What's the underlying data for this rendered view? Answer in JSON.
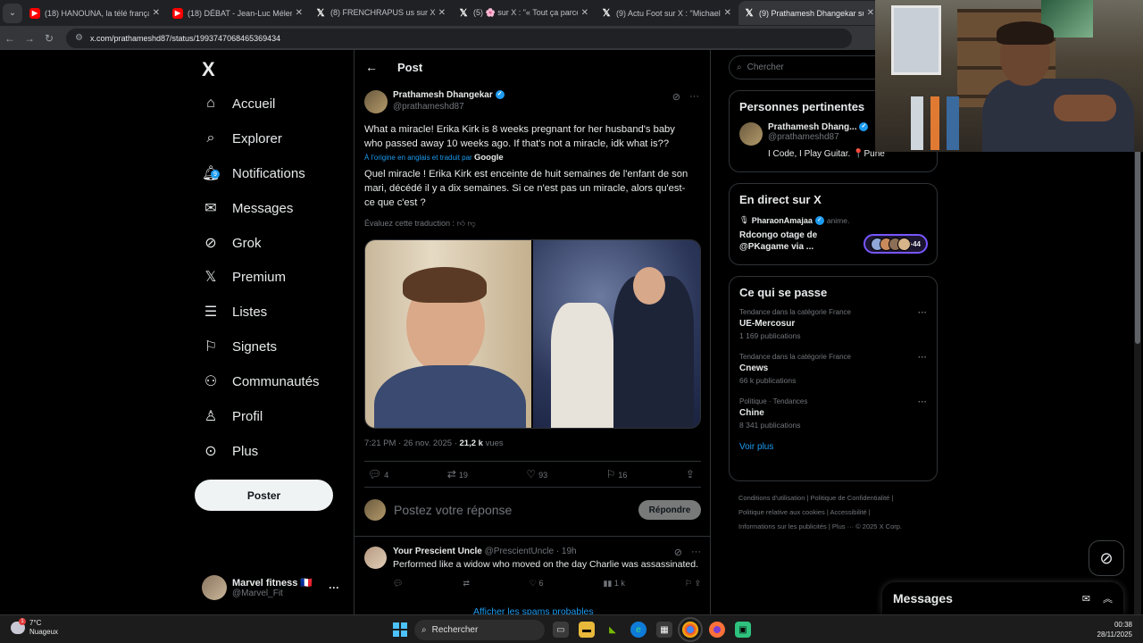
{
  "browser": {
    "tabs": [
      {
        "label": "(18) HANOUNA, la télé français",
        "icon": "youtube-icon",
        "active": false
      },
      {
        "label": "(18) DÉBAT - Jean-Luc Mélench",
        "icon": "youtube-icon",
        "active": false
      },
      {
        "label": "(8) FRENCHRAPUS us sur X : \" 🎩",
        "icon": "x-logo-icon",
        "active": false
      },
      {
        "label": "(5) 🌸 sur X : \"« Tout ça parce q",
        "icon": "x-logo-icon",
        "active": false
      },
      {
        "label": "(9) Actu Foot sur X : \"Michael O",
        "icon": "x-logo-icon",
        "active": false
      },
      {
        "label": "(9) Prathamesh Dhangekar sur",
        "icon": "x-logo-icon",
        "active": true
      }
    ],
    "url": "x.com/prathameshd87/status/1993747068465369434"
  },
  "sidebar": {
    "logo": "X",
    "items": [
      {
        "label": "Accueil",
        "icon": "home-icon"
      },
      {
        "label": "Explorer",
        "icon": "search-icon"
      },
      {
        "label": "Notifications",
        "icon": "bell-icon",
        "badge": "9"
      },
      {
        "label": "Messages",
        "icon": "envelope-icon"
      },
      {
        "label": "Grok",
        "icon": "grok-icon"
      },
      {
        "label": "Premium",
        "icon": "x-logo-icon"
      },
      {
        "label": "Listes",
        "icon": "list-icon"
      },
      {
        "label": "Signets",
        "icon": "bookmark-icon"
      },
      {
        "label": "Communautés",
        "icon": "people-icon"
      },
      {
        "label": "Profil",
        "icon": "person-icon"
      },
      {
        "label": "Plus",
        "icon": "more-circle-icon"
      }
    ],
    "post_button": "Poster",
    "account": {
      "name": "Marvel fitness 🇫🇷",
      "handle": "@Marvel_Fit",
      "more": "···"
    }
  },
  "post": {
    "header": "Post",
    "author_name": "Prathamesh Dhangekar",
    "author_handle": "@prathameshd87",
    "text_original": "What a miracle! Erika Kirk is 8 weeks pregnant for her husband's baby who passed away 10 weeks ago. If that's not a miracle, idk what is??",
    "translation_note": "À l'origine en anglais et traduit par",
    "translation_provider": "Google",
    "text_translated": "Quel miracle ! Erika Kirk est enceinte de huit semaines de l'enfant de son mari, décédé il y a dix semaines. Si ce n'est pas un miracle, alors qu'est-ce que c'est ?",
    "rate_translation": "Évaluez cette traduction :",
    "time": "7:21 PM · 26 nov. 2025 ·",
    "views_count": "21,2 k",
    "views_label": "vues",
    "actions": {
      "replies": "4",
      "reposts": "19",
      "likes": "93",
      "bookmarks": "16"
    },
    "reply_placeholder": "Postez votre réponse",
    "reply_button": "Répondre"
  },
  "reply": {
    "name": "Your Prescient Uncle",
    "handle": "@PrescientUncle",
    "age": "· 19h",
    "text": "Performed like a widow who moved on the day Charlie was assassinated.",
    "likes": "6",
    "views": "1 k"
  },
  "spam_link": "Afficher les spams probables",
  "right": {
    "search_placeholder": "Chercher",
    "relevant": {
      "title": "Personnes pertinentes",
      "name": "Prathamesh Dhang...",
      "handle": "@prathameshd87",
      "bio": "I Code, I Play Guitar. 📍Pune"
    },
    "live": {
      "title": "En direct sur X",
      "user": "PharaonAmajaa",
      "role": "anime.",
      "topic": "Rdcongo otage de @PKagame via ...",
      "count": "+44"
    },
    "trends": {
      "title": "Ce qui se passe",
      "items": [
        {
          "context": "Tendance dans la catégorie France",
          "name": "UE-Mercosur",
          "posts": "1 169 publications"
        },
        {
          "context": "Tendance dans la catégorie France",
          "name": "Cnews",
          "posts": "66 k publications"
        },
        {
          "context": "Politique · Tendances",
          "name": "Chine",
          "posts": "8 341 publications"
        }
      ],
      "more": "Voir plus"
    },
    "footer": [
      "Conditions d'utilisation",
      "Politique de Confidentialité",
      "Politique relative aux cookies",
      "Accessibilité",
      "Informations sur les publicités",
      "Plus ···",
      "© 2025 X Corp."
    ]
  },
  "messages_dock": {
    "title": "Messages"
  },
  "taskbar": {
    "temp": "7°C",
    "weather": "Nuageux",
    "weather_badge": "1",
    "search": "Rechercher",
    "time": "00:38",
    "date": "28/11/2025"
  }
}
